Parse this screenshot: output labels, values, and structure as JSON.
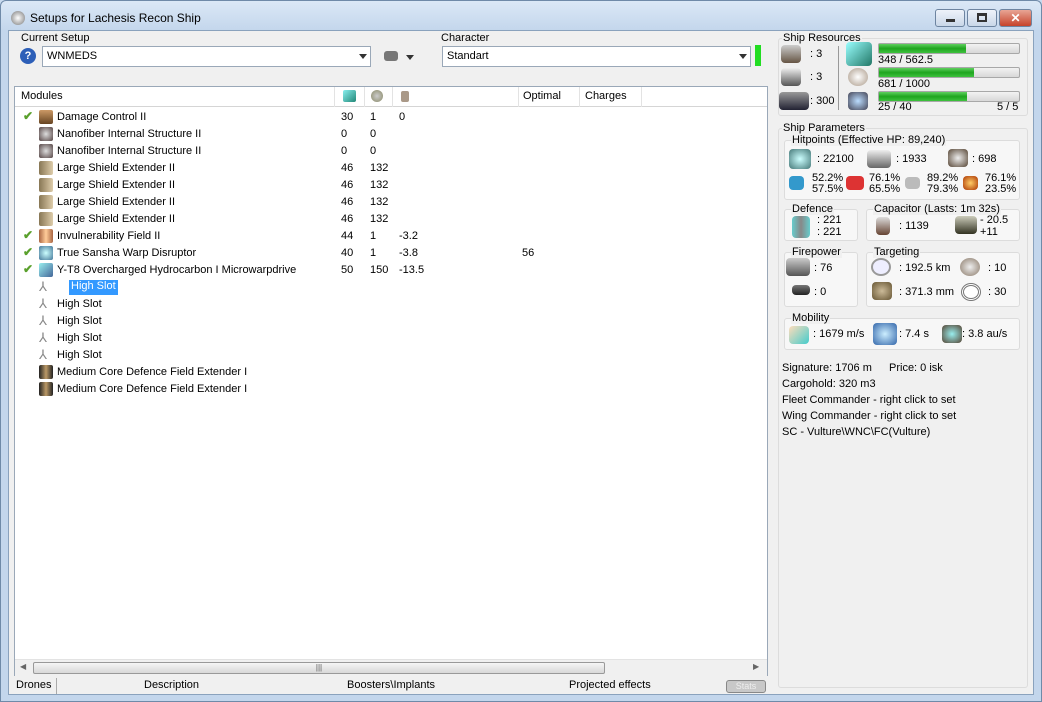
{
  "window": {
    "title": "Setups for Lachesis Recon Ship"
  },
  "setup": {
    "label": "Current Setup",
    "value": "WNMEDS"
  },
  "character": {
    "label": "Character",
    "value": "Standart"
  },
  "modules": {
    "headers": [
      "Modules",
      "",
      "",
      "",
      "Optimal",
      "Charges"
    ],
    "rows": [
      {
        "name": "Damage Control II",
        "active": true,
        "icon": "damage-control-icon",
        "c1": "30",
        "c2": "1",
        "c3": "0",
        "optimal": ""
      },
      {
        "name": "Nanofiber Internal Structure II",
        "active": false,
        "icon": "nanofiber-icon",
        "c1": "0",
        "c2": "0",
        "c3": "",
        "optimal": ""
      },
      {
        "name": "Nanofiber Internal Structure II",
        "active": false,
        "icon": "nanofiber-icon",
        "c1": "0",
        "c2": "0",
        "c3": "",
        "optimal": ""
      },
      {
        "name": "Large Shield Extender II",
        "active": false,
        "icon": "shield-extender-icon",
        "c1": "46",
        "c2": "132",
        "c3": "",
        "optimal": ""
      },
      {
        "name": "Large Shield Extender II",
        "active": false,
        "icon": "shield-extender-icon",
        "c1": "46",
        "c2": "132",
        "c3": "",
        "optimal": ""
      },
      {
        "name": "Large Shield Extender II",
        "active": false,
        "icon": "shield-extender-icon",
        "c1": "46",
        "c2": "132",
        "c3": "",
        "optimal": ""
      },
      {
        "name": "Large Shield Extender II",
        "active": false,
        "icon": "shield-extender-icon",
        "c1": "46",
        "c2": "132",
        "c3": "",
        "optimal": ""
      },
      {
        "name": "Invulnerability Field II",
        "active": true,
        "icon": "invulnerability-field-icon",
        "c1": "44",
        "c2": "1",
        "c3": "-3.2",
        "optimal": ""
      },
      {
        "name": "True Sansha Warp Disruptor",
        "active": true,
        "icon": "warp-disruptor-icon",
        "c1": "40",
        "c2": "1",
        "c3": "-3.8",
        "optimal": "56"
      },
      {
        "name": "Y-T8 Overcharged Hydrocarbon I Microwarpdrive",
        "active": true,
        "icon": "microwarpdrive-icon",
        "c1": "50",
        "c2": "150",
        "c3": "-13.5",
        "optimal": ""
      },
      {
        "name": "High Slot",
        "active": false,
        "icon": "high-slot-icon",
        "selected": true
      },
      {
        "name": "High Slot",
        "active": false,
        "icon": "high-slot-icon"
      },
      {
        "name": "High Slot",
        "active": false,
        "icon": "high-slot-icon"
      },
      {
        "name": "High Slot",
        "active": false,
        "icon": "high-slot-icon"
      },
      {
        "name": "High Slot",
        "active": false,
        "icon": "high-slot-icon"
      },
      {
        "name": "Medium Core Defence Field Extender I",
        "active": false,
        "icon": "rig-icon"
      },
      {
        "name": "Medium Core Defence Field Extender I",
        "active": false,
        "icon": "rig-icon"
      }
    ]
  },
  "bottom_tabs": [
    "Drones",
    "Description",
    "Boosters\\Implants",
    "Projected effects"
  ],
  "stats_button": "Stats",
  "resources": {
    "label": "Ship Resources",
    "turrets": ": 3",
    "launchers": ": 3",
    "calibration": ": 300",
    "cpu": "348 / 562.5",
    "cpu_pct": 61.9,
    "power": "681 / 1000",
    "power_pct": 68.1,
    "drone_bw": "25 / 40",
    "drone_pct": 62.5,
    "drones": "5 / 5"
  },
  "params": {
    "label": "Ship Parameters",
    "hitpoints": {
      "label": "Hitpoints (Effective HP: 89,240)",
      "shield": ": 22100",
      "armor": ": 1933",
      "structure": ": 698",
      "em": [
        "52.2%",
        "57.5%"
      ],
      "thermal": [
        "76.1%",
        "65.5%"
      ],
      "kinetic": [
        "89.2%",
        "79.3%"
      ],
      "explosive": [
        "76.1%",
        "23.5%"
      ]
    },
    "defence": {
      "label": "Defence",
      "a": ": 221",
      "b": ": 221"
    },
    "capacitor": {
      "label": "Capacitor (Lasts: 1m 32s)",
      "amount": ": 1139",
      "use": "- 20.5",
      "regen": "+11"
    },
    "firepower": {
      "label": "Firepower",
      "turret": ": 76",
      "missile": ": 0"
    },
    "targeting": {
      "label": "Targeting",
      "range": ": 192.5 km",
      "targets": ": 10",
      "sensor": ": 371.3 mm",
      "scan": ": 30"
    },
    "mobility": {
      "label": "Mobility",
      "speed": ": 1679 m/s",
      "align": ": 7.4 s",
      "warp": ": 3.8 au/s"
    },
    "lines": [
      "Signature: 1706 m",
      "Price: 0 isk",
      "Cargohold: 320 m3",
      "Fleet Commander - right click to set",
      "Wing Commander - right click to set",
      "SC - Vulture\\WNC\\FC(Vulture)"
    ]
  }
}
